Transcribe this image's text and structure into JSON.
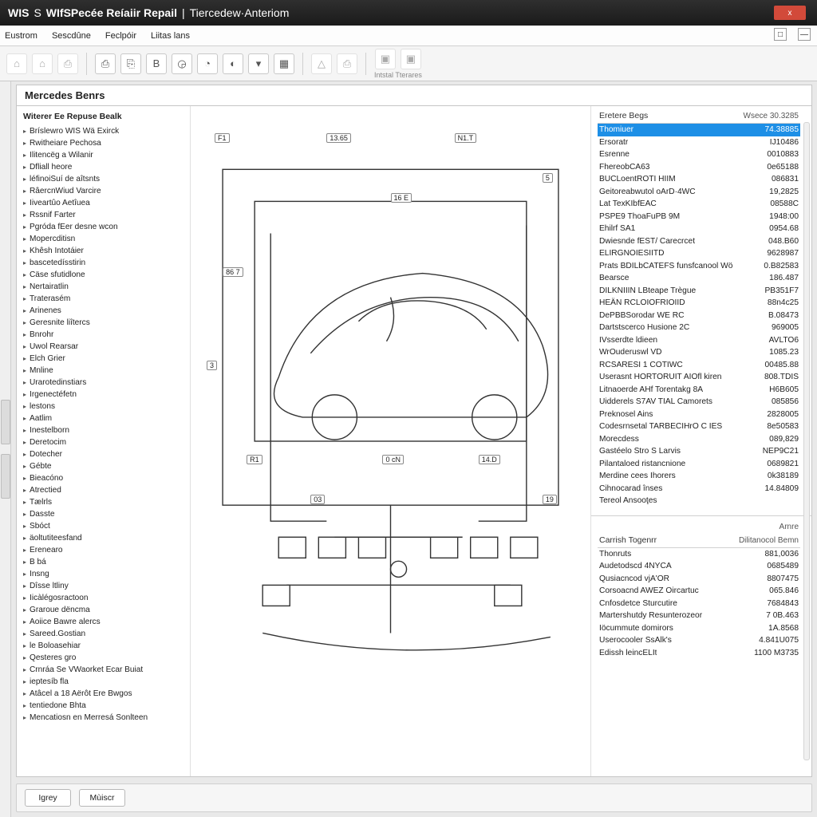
{
  "title": {
    "seg1": "WIS",
    "seg2": "S",
    "seg3": "WIfSPecée Reíaiir Repail",
    "sep": "|",
    "seg4": "Tiercedew·Anteriom",
    "close": "x"
  },
  "menu": {
    "items": [
      "Eustrom",
      "Sescdûne",
      "Feclpóir",
      "Liitas lans"
    ],
    "maximize": "□",
    "minimize": "—"
  },
  "toolbar": {
    "icons": [
      "⌂",
      "⌂",
      "⎙",
      "⎙",
      "⎘",
      "B",
      "◶",
      "◔",
      "◐",
      "▾",
      "▦",
      "",
      "△",
      "⎙",
      "",
      "▣",
      "▣"
    ],
    "group_label": "Intstal Tterares"
  },
  "panel": {
    "header": "Mercedes Benrs"
  },
  "tree": {
    "title": "Witerer Ee Repuse Bealk",
    "items": [
      "Bríslewro WIS Wä Exirck",
      "Rwitheiare Pechosa",
      "Ilitencëg a Wilanir",
      "Dfliall heore",
      "léfinoiSuí de aîtsnts",
      "RâercnWiud Varcire",
      "Iiveartûo Aetîuea",
      "Rssnif Farter",
      "Pgróda fEer desne wcon",
      "Mopercditisn",
      "Khêsh Intotáier",
      "bascetedísstirin",
      "Cäse sfutidlone",
      "Nertairatlin",
      "Traterasém",
      "Arinenes",
      "Geresnite liîtercs",
      "Bnrohr",
      "Uwol Rearsar",
      "Elch Grier",
      "Mnline",
      "Urarotedinstiars",
      "Irgenectéfetn",
      "lestons",
      "Aatlim",
      "Inestelborn",
      "Deretocim",
      "Dotecher",
      "Gébte",
      "Bieacóno",
      "Atrectied",
      "Tælrls",
      "Dasste",
      "Sbóct",
      "äoltutiteesfand",
      "Erenearo",
      "B bá",
      "Insng",
      "Dîsse ltliny",
      "Iicàlégosractoon",
      "Graroue dëncma",
      "Aoiice Bawre alercs",
      "Sareed.Gostian",
      "le Boloasehiar",
      "Qesteres gro",
      "Crnráa Se VWaorket Ecar Buiat",
      "ieptesíb fla",
      "Atâcel a 18 Aërôt Ere Bwgos",
      "tentiedone Bhta",
      "Mencatiosn en Merresá Sonlteen"
    ]
  },
  "diagram": {
    "callouts": {
      "c1": "F1",
      "c2": "13.65",
      "c3": "N1.T",
      "c4": "5",
      "c5": "16 E",
      "c6": "86 7",
      "c7": "3",
      "c8": "R1",
      "c9": "0 cN",
      "c10": "03",
      "c11": "14.D",
      "c12": "19"
    }
  },
  "right_top": {
    "h1": "Eretere Begs",
    "h2": "Wsece 30.3285",
    "rows": [
      {
        "n": "Thomiuer",
        "v": "74.38885",
        "sel": true
      },
      {
        "n": "Ersoratr",
        "v": "IJ10486"
      },
      {
        "n": "Esrenne",
        "v": "0010883"
      },
      {
        "n": "FhereobCA63",
        "v": "0e65188"
      },
      {
        "n": "BUCLoentROTI HIIM",
        "v": "086831"
      },
      {
        "n": "Geitoreabwutol oArD·4WC",
        "v": "19,2825"
      },
      {
        "n": "Lat TexKIbfEAC",
        "v": "08588C"
      },
      {
        "n": "PSPE9 ThoaFuPB 9M",
        "v": "1948:00"
      },
      {
        "n": "Ehilrf SA1",
        "v": "0954.68"
      },
      {
        "n": "Dwiesnde fEST/ Carecrcet",
        "v": "048.B60"
      },
      {
        "n": "ELIRGNOIESIITD",
        "v": "9628987"
      },
      {
        "n": "Prats BDILbCATEFS funsfcanool Wö",
        "v": "0.B82583"
      },
      {
        "n": "Bearsce",
        "v": "186.487"
      },
      {
        "n": "DILKNIIIN LBteape Trègue",
        "v": "PB351F7"
      },
      {
        "n": "HEÄN RCLOIOFRIOIID",
        "v": "88n4c25"
      },
      {
        "n": "DePBBSorodar WE RC",
        "v": "B.08473"
      },
      {
        "n": "Dartstscerco Husione 2C",
        "v": "969005"
      },
      {
        "n": "IVsserdte ldieen",
        "v": "AVLTO6"
      },
      {
        "n": "WrOuderuswl VD",
        "v": "1085.23"
      },
      {
        "n": "RCSARESI 1 COTIWC",
        "v": "00485.88"
      },
      {
        "n": "Userasnt HORTORUIT AIOfl kiren",
        "v": "808.TDIS"
      },
      {
        "n": "Litnaoerde AHf Torentakg 8A",
        "v": "H6B605"
      },
      {
        "n": "Uidderels S7AV TIAL Camorets",
        "v": "085856"
      },
      {
        "n": "Preknosel Ains",
        "v": "2828005"
      },
      {
        "n": "Codesrnsetal TARBECIHrO C IES",
        "v": "8e50583"
      },
      {
        "n": "Morecdess",
        "v": "089,829"
      },
      {
        "n": "Gastéelo Stro S Larvis",
        "v": "NEP9C21"
      },
      {
        "n": "Pilantaloed ristancnione",
        "v": "0689821"
      },
      {
        "n": "Merdine cees Ihorers",
        "v": "0k38189"
      },
      {
        "n": "Cihnocarad înses",
        "v": "14.84809"
      },
      {
        "n": "Tereol Ansooţes",
        "v": ""
      }
    ]
  },
  "right_bottom": {
    "h1": "Carrish Togenrr",
    "h2a": "Arnre",
    "h2b": "Dilitanocol Bemn",
    "rows": [
      {
        "n": "Thonruts",
        "v": "881,0036"
      },
      {
        "n": "Audetodscd 4NYCA",
        "v": "0685489"
      },
      {
        "n": "Qusiacncod vjA'OR",
        "v": "8807475"
      },
      {
        "n": "Corsoacnd AWEZ Oircartuc",
        "v": "065.846"
      },
      {
        "n": "Cnfosdetce Sturcutire",
        "v": "7684843"
      },
      {
        "n": "Martershutdy Resunterozeor",
        "v": "7 0B.463"
      },
      {
        "n": "Iöcummute domirors",
        "v": "1A.8568"
      },
      {
        "n": "Userocooler SsAlk's",
        "v": "4.841U075"
      },
      {
        "n": "Edissh leincELIt",
        "v": "1100 M3735"
      }
    ]
  },
  "footer": {
    "b1": "Igrey",
    "b2": "Mùiscr"
  }
}
